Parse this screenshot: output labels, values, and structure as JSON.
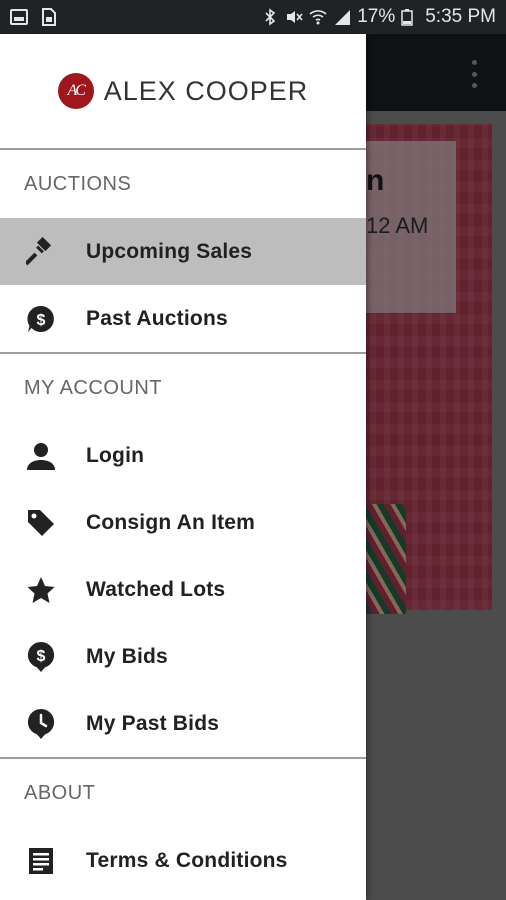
{
  "status_bar": {
    "battery": "17%",
    "time": "5:35 PM",
    "icons": [
      "image-icon",
      "sim-icon",
      "bluetooth-icon",
      "mute-icon",
      "wifi-icon",
      "signal-icon",
      "battery-icon"
    ]
  },
  "background": {
    "title_partial": "n",
    "time_partial": "12 AM"
  },
  "drawer": {
    "brand": {
      "logo_text": "AC",
      "name": "ALEX COOPER"
    },
    "sections": [
      {
        "header": "AUCTIONS",
        "items": [
          {
            "label": "Upcoming Sales",
            "icon": "gavel-icon",
            "active": true
          },
          {
            "label": "Past Auctions",
            "icon": "dollar-chat-icon",
            "active": false
          }
        ]
      },
      {
        "header": "MY ACCOUNT",
        "items": [
          {
            "label": "Login",
            "icon": "person-icon"
          },
          {
            "label": "Consign An Item",
            "icon": "tag-icon"
          },
          {
            "label": "Watched Lots",
            "icon": "star-icon"
          },
          {
            "label": "My Bids",
            "icon": "dollar-pin-icon"
          },
          {
            "label": "My Past Bids",
            "icon": "clock-pin-icon"
          }
        ]
      },
      {
        "header": "ABOUT",
        "items": [
          {
            "label": "Terms & Conditions",
            "icon": "document-icon"
          }
        ]
      }
    ]
  },
  "colors": {
    "brand_red": "#a0161d",
    "active_item_bg": "#bdbdbd",
    "statusbar_bg": "#1f2326"
  }
}
